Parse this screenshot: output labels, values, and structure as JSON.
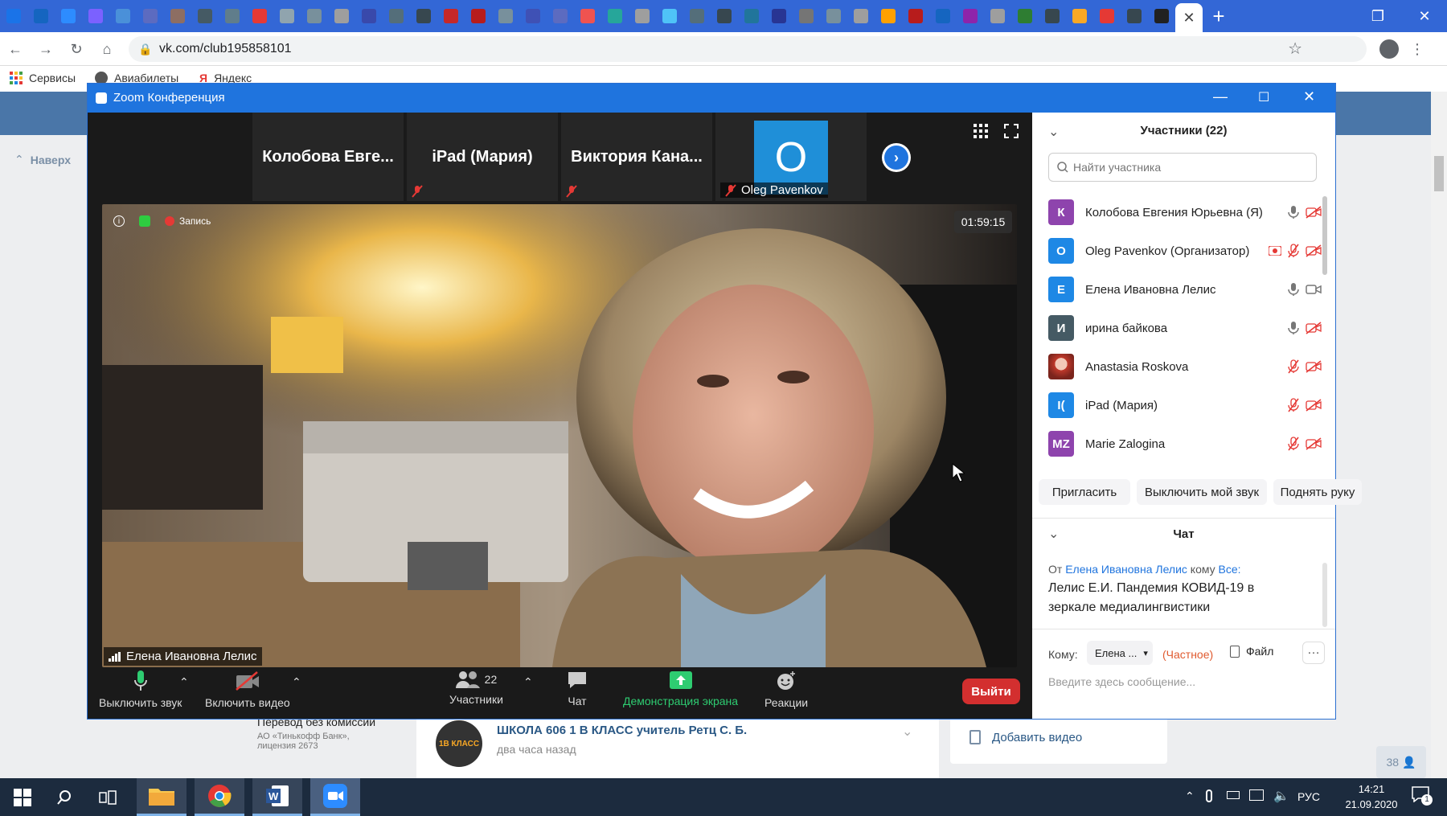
{
  "browser": {
    "tab_favicon_colors": [
      "#1a73e8",
      "#1565c0",
      "#2d8cff",
      "#7b61ff",
      "#4a90d9",
      "#5c6bc0",
      "#8d6e63",
      "#455a64",
      "#607d8b",
      "#e53935",
      "#90a4ae",
      "#78909c",
      "#9e9e9e",
      "#3949ab",
      "#546e7a",
      "#37474f",
      "#c62828",
      "#b71c1c",
      "#78909c",
      "#3f51b5",
      "#5c6bc0",
      "#ef5350",
      "#26a69a",
      "#9e9e9e",
      "#4fc3f7",
      "#546e7a",
      "#37474f",
      "#21759b",
      "#283593",
      "#757575",
      "#78909c",
      "#9e9e9e",
      "#ffa000",
      "#b71c1c",
      "#1565c0",
      "#8e24aa",
      "#9e9e9e",
      "#2e7d32",
      "#37474f",
      "#f9a825",
      "#e53935",
      "#37474f",
      "#212121"
    ],
    "url": "vk.com/club195858101",
    "bookmarks": [
      {
        "icon": "apps-grid-icon",
        "label": "Сервисы"
      },
      {
        "icon": "aviasales-icon",
        "label": "Авиабилеты"
      },
      {
        "icon": "yandex-icon",
        "label": "Яндекс"
      }
    ]
  },
  "vk": {
    "back_to_top": "Наверх",
    "ad_title": "Перевод без комиссии",
    "ad_subtitle": "АО «Тинькофф Банк», лицензия 2673",
    "post_author": "ШКОЛА 606 1 В КЛАСС учитель Ретц С. Б.",
    "post_time": "два часа назад",
    "post_avatar_text": "1В КЛАСС",
    "add_video": "Добавить видео",
    "counter": "38"
  },
  "zoom": {
    "window_title": "Zoom Конференция",
    "thumbnails": [
      {
        "label": "Колобова Евге..."
      },
      {
        "label": "iPad (Мария)"
      },
      {
        "label": "Виктория Кана..."
      },
      {
        "label": "Oleg Pavenkov",
        "avatar_letter": "O"
      }
    ],
    "recording_label": "Запись",
    "timer": "01:59:15",
    "speaker_name": "Елена Ивановна Лелис",
    "toolbar": {
      "mute": "Выключить звук",
      "video": "Включить видео",
      "participants": "Участники",
      "participants_count": "22",
      "chat": "Чат",
      "share": "Демонстрация экрана",
      "reactions": "Реакции",
      "leave": "Выйти"
    },
    "panel": {
      "participants_title": "Участники (22)",
      "search_placeholder": "Найти участника",
      "participants": [
        {
          "initials": "К",
          "name": "Колобова Евгения Юрьевна  (Я)",
          "color": "#8e44ad",
          "mic": "on",
          "video": "off"
        },
        {
          "initials": "O",
          "name": "Oleg Pavenkov (Организатор)",
          "color": "#1e88e5",
          "mic": "off",
          "video": "off",
          "recording": true
        },
        {
          "initials": "Е",
          "name": "Елена Ивановна Лелис",
          "color": "#1e88e5",
          "mic": "on",
          "video": "on"
        },
        {
          "initials": "И",
          "name": "ирина байкова",
          "color": "#455a64",
          "mic": "on",
          "video": "off"
        },
        {
          "initials": "",
          "name": "Anastasia Roskova",
          "color": "#e57373",
          "mic": "off",
          "video": "off",
          "photo": true
        },
        {
          "initials": "I(",
          "name": "iPad (Мария)",
          "color": "#1e88e5",
          "mic": "off",
          "video": "off"
        },
        {
          "initials": "MZ",
          "name": "Marie Zalogina",
          "color": "#8e44ad",
          "mic": "off",
          "video": "off"
        }
      ],
      "invite": "Пригласить",
      "mute_me": "Выключить мой звук",
      "raise_hand": "Поднять руку",
      "chat_title": "Чат",
      "chat_from_prefix": "От",
      "chat_sender": "Елена Ивановна Лелис",
      "chat_to_word": "кому",
      "chat_to_all": "Все:",
      "chat_message": "Лелис Е.И. Пандемия КОВИД-19 в зеркале медиалингвистики",
      "to_label": "Кому:",
      "to_value": "Елена ...",
      "private": "(Частное)",
      "file": "Файл",
      "input_placeholder": "Введите здесь сообщение..."
    }
  },
  "taskbar": {
    "lang": "РУС",
    "time": "14:21",
    "date": "21.09.2020",
    "notifications": "1"
  }
}
